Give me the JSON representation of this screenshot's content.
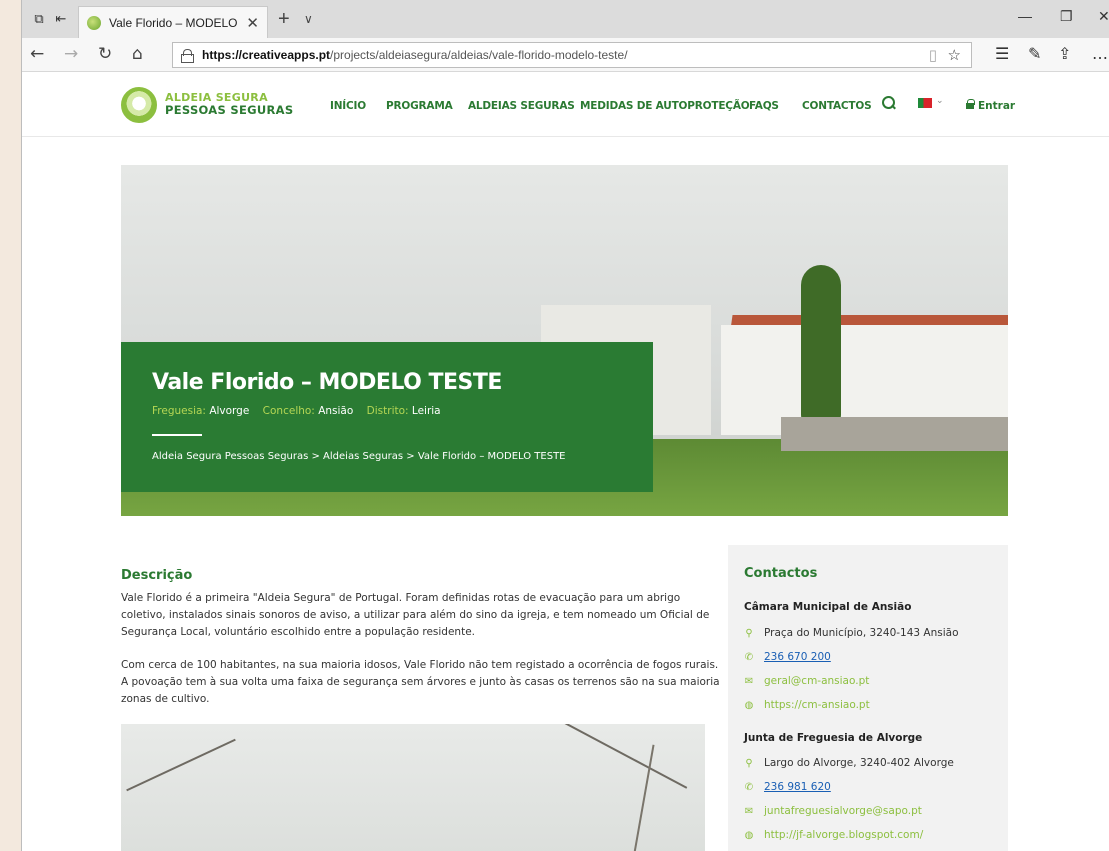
{
  "browser": {
    "tab_title": "Vale Florido – MODELO",
    "url_host": "https://creativeapps.pt",
    "url_path": "/projects/aldeiasegura/aldeias/vale-florido-modelo-teste/"
  },
  "header": {
    "logo_line1": "ALDEIA SEGURA",
    "logo_line2": "PESSOAS SEGURAS",
    "menu": [
      "INÍCIO",
      "PROGRAMA",
      "ALDEIAS SEGURAS",
      "MEDIDAS DE AUTOPROTEÇÃO",
      "FAQS",
      "CONTACTOS"
    ],
    "login_label": "Entrar"
  },
  "hero": {
    "title": "Vale Florido – MODELO TESTE",
    "freguesia_label": "Freguesia:",
    "freguesia": "Alvorge",
    "concelho_label": "Concelho:",
    "concelho": "Ansião",
    "distrito_label": "Distrito:",
    "distrito": "Leiria",
    "breadcrumb": "Aldeia Segura Pessoas Seguras > Aldeias Seguras > Vale Florido – MODELO TESTE"
  },
  "description": {
    "title": "Descrição",
    "p1": "Vale Florido é a primeira \"Aldeia Segura\" de Portugal. Foram definidas rotas de evacuação para um abrigo coletivo, instalados sinais sonoros de aviso, a utilizar para além do sino da igreja, e tem nomeado um Oficial de Segurança Local, voluntário escolhido entre a população residente.",
    "p2": "Com cerca de 100 habitantes, na sua maioria idosos, Vale Florido não tem registado a ocorrência de fogos rurais. A povoação tem à sua volta uma faixa de segurança sem árvores e junto às casas os terrenos são na sua maioria zonas de cultivo."
  },
  "contacts": {
    "title": "Contactos",
    "orgs": [
      {
        "name": "Câmara Municipal de Ansião",
        "address": "Praça do Município, 3240-143 Ansião",
        "phone": "236 670 200",
        "email": "geral@cm-ansiao.pt",
        "web": "https://cm-ansiao.pt"
      },
      {
        "name": "Junta de Freguesia de Alvorge",
        "address": "Largo do Alvorge, 3240-402 Alvorge",
        "phone": "236 981 620",
        "email": "juntafreguesialvorge@sapo.pt",
        "web": "http://jf-alvorge.blogspot.com/"
      }
    ]
  },
  "colors": {
    "brand_green": "#2b7a32",
    "light_green": "#8cbf3f",
    "link_blue": "#1a5fb4"
  }
}
